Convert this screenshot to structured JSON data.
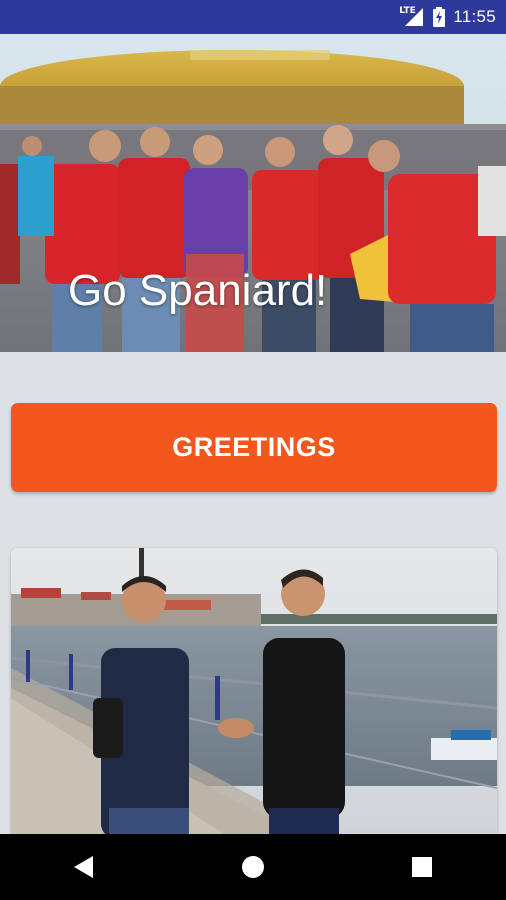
{
  "status_bar": {
    "network_label": "LTE",
    "time": "11:55",
    "icons": [
      "lte-signal-icon",
      "battery-charging-icon"
    ]
  },
  "hero": {
    "caption": "Go Spaniard!"
  },
  "greetings_button": {
    "label": "GREETINGS"
  },
  "nav_bar": {
    "icons": [
      "back-icon",
      "home-icon",
      "recents-icon"
    ]
  },
  "colors": {
    "status_bar": "#2e3a9b",
    "accent": "#f4571d",
    "background": "#dde1e3"
  }
}
